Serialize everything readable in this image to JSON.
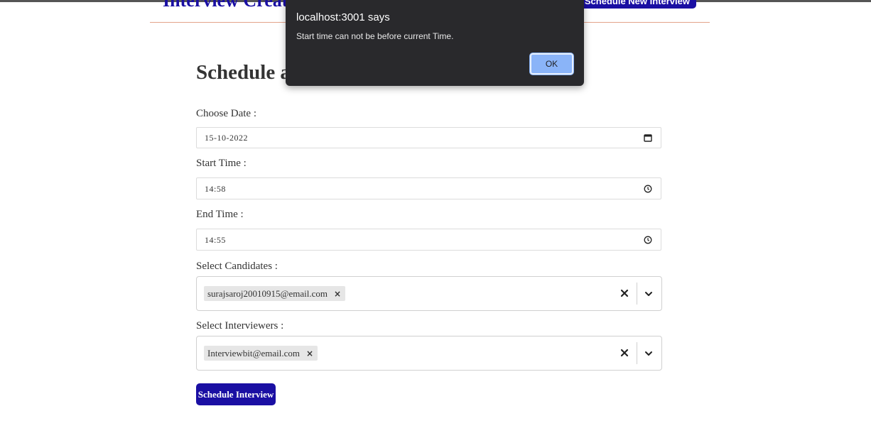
{
  "header": {
    "brand": "Interview Creation",
    "new_interview_button": "Schedule New Interview"
  },
  "page": {
    "title": "Schedule an Interview"
  },
  "form": {
    "date": {
      "label": "Choose Date :",
      "value": "15-10-2022"
    },
    "start_time": {
      "label": "Start Time :",
      "value": "14:58"
    },
    "end_time": {
      "label": "End Time :",
      "value": "14:55"
    },
    "candidates": {
      "label": "Select Candidates :",
      "selected": [
        "surajsaroj20010915@email.com"
      ]
    },
    "interviewers": {
      "label": "Select Interviewers :",
      "selected": [
        "Interviewbit@email.com"
      ]
    },
    "submit_label": "Schedule Interview"
  },
  "alert": {
    "title": "localhost:3001 says",
    "message": "Start time can not be before current Time.",
    "ok_label": "OK"
  },
  "colors": {
    "accent": "#1a0fa3",
    "header_border": "#e3a38a",
    "dialog_bg": "#29292c",
    "ok_button": "#8ab4f8"
  },
  "icons": {
    "date": "calendar-icon",
    "time": "clock-icon",
    "clear": "close-icon",
    "dropdown": "chevron-down-icon",
    "chip_remove": "close-icon"
  }
}
